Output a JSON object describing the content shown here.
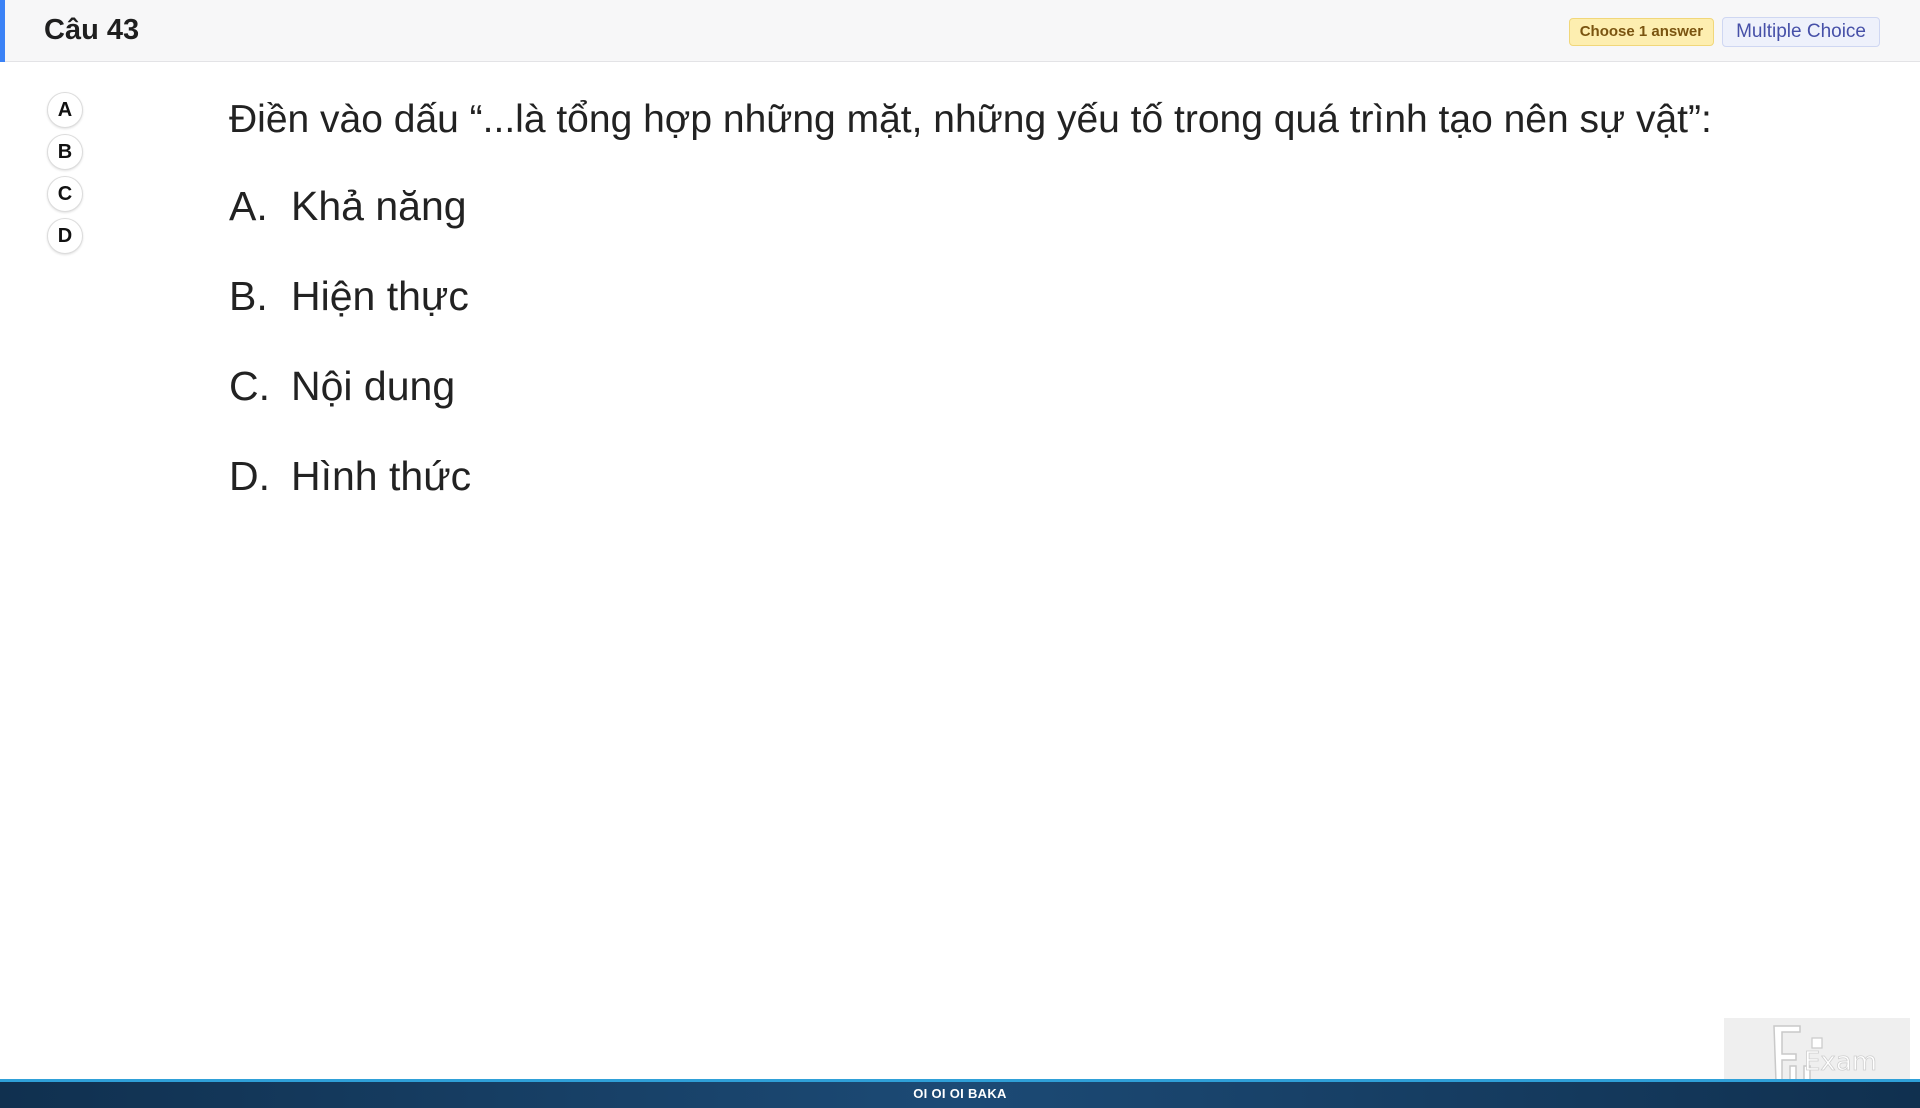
{
  "header": {
    "title": "Câu 43",
    "badge_choose": "Choose 1 answer",
    "badge_type": "Multiple Choice",
    "accent_color": "#3b82f6"
  },
  "selector": {
    "choices": [
      "A",
      "B",
      "C",
      "D"
    ]
  },
  "question": {
    "text": "Điền vào dấu “...là tổng hợp những mặt, những yếu tố trong quá trình tạo nên sự vật”:",
    "options": [
      {
        "letter": "A.",
        "text": "Khả năng"
      },
      {
        "letter": "B.",
        "text": "Hiện thực"
      },
      {
        "letter": "C.",
        "text": "Nội dung"
      },
      {
        "letter": "D.",
        "text": "Hình thức"
      }
    ]
  },
  "footer": {
    "text": "OI OI OI BAKA"
  },
  "logo": {
    "text": "Exam",
    "icon": "fu-exam-logo-icon"
  }
}
